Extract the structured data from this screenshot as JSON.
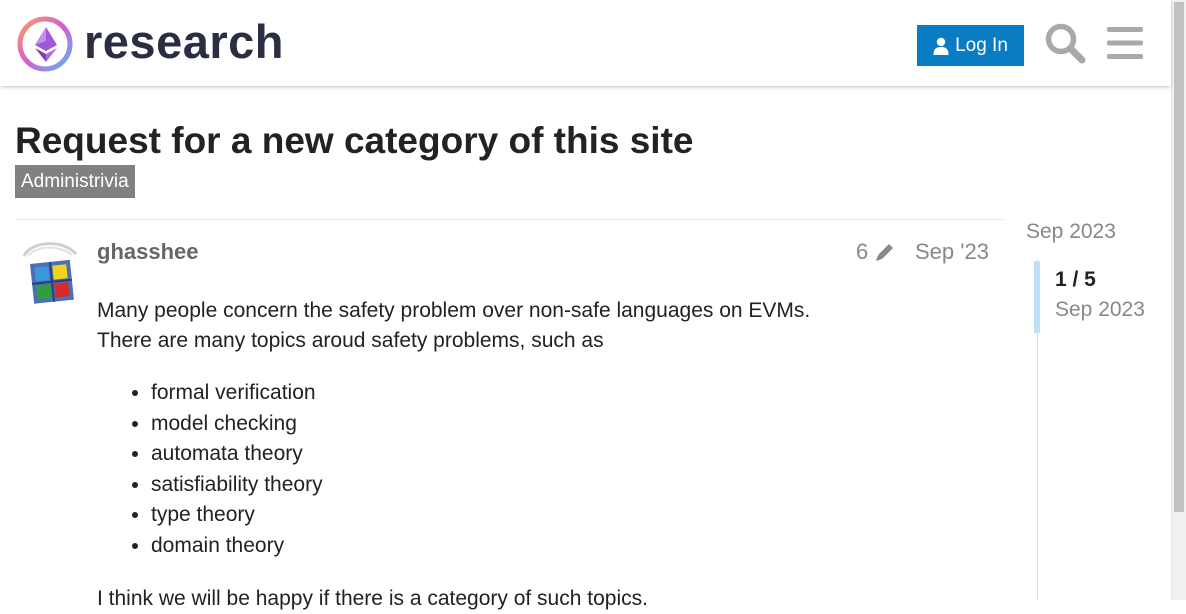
{
  "header": {
    "brand": "research",
    "login_label": "Log In",
    "icons": {
      "logo": "ethereum-research-logo",
      "user": "user-icon",
      "search": "search-icon",
      "menu": "hamburger-menu-icon"
    }
  },
  "topic": {
    "title": "Request for a new category of this site",
    "category": "Administrivia"
  },
  "post": {
    "username": "ghasshee",
    "edit_count": "6",
    "date": "Sep '23",
    "intro_line1": "Many people concern the safety problem over non-safe languages on EVMs.",
    "intro_line2": "There are many topics aroud safety problems, such as",
    "topics": [
      "formal verification",
      "model checking",
      "automata theory",
      "satisfiability theory",
      "type theory",
      "domain theory"
    ],
    "outro": "I think we will be happy if there is a category of such topics."
  },
  "timeline": {
    "start_date": "Sep 2023",
    "position": "1 / 5",
    "current_date": "Sep 2023"
  },
  "colors": {
    "primary": "#0a7cc4",
    "category_badge": "#808281",
    "muted_text": "#888888",
    "timeline_handle": "#bfe1f7"
  }
}
